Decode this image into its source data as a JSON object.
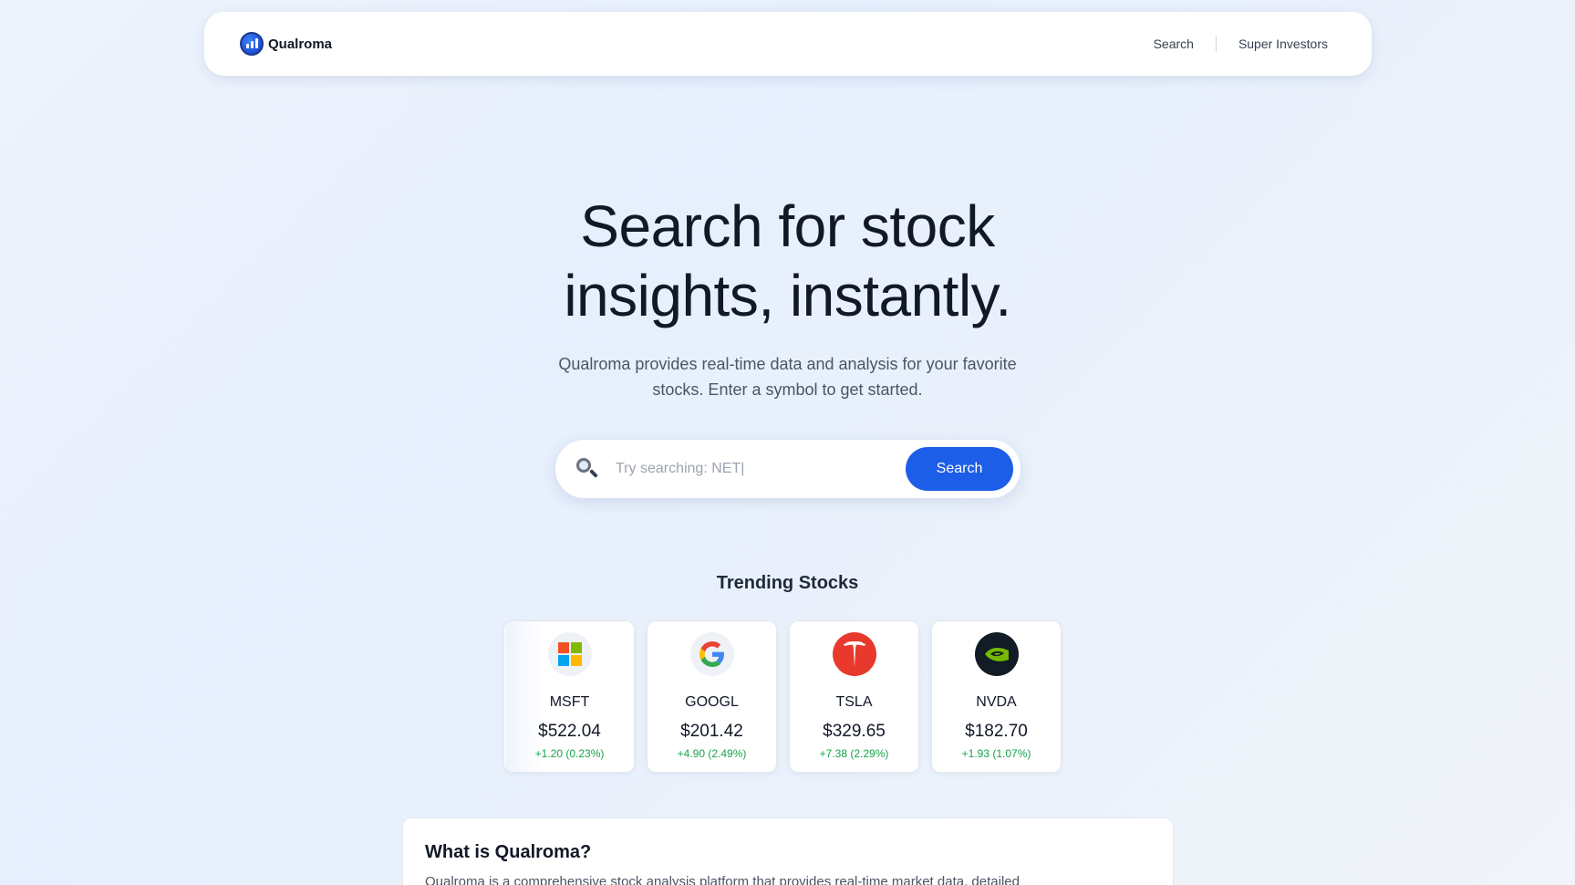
{
  "nav": {
    "brand": "Qualroma",
    "links": [
      "Search",
      "Super Investors"
    ]
  },
  "hero": {
    "title_line1": "Search for stock",
    "title_line2": "insights, instantly.",
    "subtitle_line1": "Qualroma provides real-time data and analysis for your favorite",
    "subtitle_line2": "stocks. Enter a symbol to get started."
  },
  "search": {
    "placeholder": "Try searching: NET|",
    "button_label": "Search"
  },
  "trending": {
    "title": "Trending Stocks",
    "stocks": [
      {
        "ticker": "MSFT",
        "price": "$522.04",
        "change": "+1.20 (0.23%)",
        "icon": "microsoft-logo-icon"
      },
      {
        "ticker": "GOOGL",
        "price": "$201.42",
        "change": "+4.90 (2.49%)",
        "icon": "google-logo-icon"
      },
      {
        "ticker": "TSLA",
        "price": "$329.65",
        "change": "+7.38 (2.29%)",
        "icon": "tesla-logo-icon"
      },
      {
        "ticker": "NVDA",
        "price": "$182.70",
        "change": "+1.93 (1.07%)",
        "icon": "nvidia-logo-icon"
      }
    ]
  },
  "about": {
    "title": "What is Qualroma?",
    "text": "Qualroma is a comprehensive stock analysis platform that provides real-time market data, detailed"
  },
  "colors": {
    "accent": "#1d5ee8",
    "positive": "#16a34a"
  }
}
